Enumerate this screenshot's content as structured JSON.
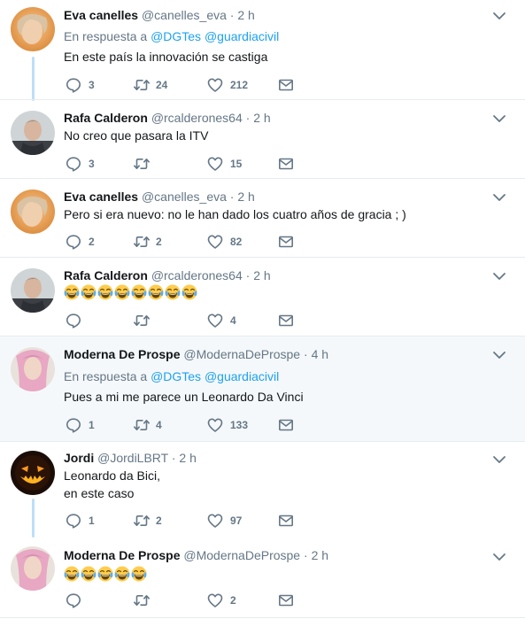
{
  "tweets": [
    {
      "name": "Eva canelles",
      "handle": "@canelles_eva",
      "time": "2 h",
      "reply_prefix": "En respuesta a",
      "reply_to": [
        "@DGTes",
        "@guardiacivil"
      ],
      "text": "En este país la innovación se castiga",
      "replies": "3",
      "retweets": "24",
      "likes": "212"
    },
    {
      "name": "Rafa Calderon",
      "handle": "@rcalderones64",
      "time": "2 h",
      "text": "No creo que pasara la ITV",
      "replies": "3",
      "retweets": "",
      "likes": "15"
    },
    {
      "name": "Eva canelles",
      "handle": "@canelles_eva",
      "time": "2 h",
      "text": "Pero si era nuevo: no le han dado los cuatro años de gracia ; )",
      "replies": "2",
      "retweets": "2",
      "likes": "82"
    },
    {
      "name": "Rafa Calderon",
      "handle": "@rcalderones64",
      "time": "2 h",
      "emoji_count": 8,
      "replies": "",
      "retweets": "",
      "likes": "4"
    },
    {
      "name": "Moderna De Prospe",
      "handle": "@ModernaDeProspe",
      "time": "4 h",
      "reply_prefix": "En respuesta a",
      "reply_to": [
        "@DGTes",
        "@guardiacivil"
      ],
      "text": "Pues a mi me parece un Leonardo Da Vinci",
      "replies": "1",
      "retweets": "4",
      "likes": "133"
    },
    {
      "name": "Jordi",
      "handle": "@JordiLBRT",
      "time": "2 h",
      "text_lines": [
        "Leonardo da Bici,",
        "en este caso"
      ],
      "replies": "1",
      "retweets": "2",
      "likes": "97"
    },
    {
      "name": "Moderna De Prospe",
      "handle": "@ModernaDeProspe",
      "time": "2 h",
      "emoji_count": 5,
      "replies": "",
      "retweets": "",
      "likes": "2"
    }
  ],
  "icons": [
    "reply-icon",
    "retweet-icon",
    "like-icon",
    "message-icon",
    "chevron-down-icon",
    "face-with-tears-of-joy-emoji"
  ],
  "colors": {
    "link": "#1da1f2",
    "secondary": "#657786",
    "thread": "#bcdff7",
    "highlight": "#f5f8fa"
  }
}
